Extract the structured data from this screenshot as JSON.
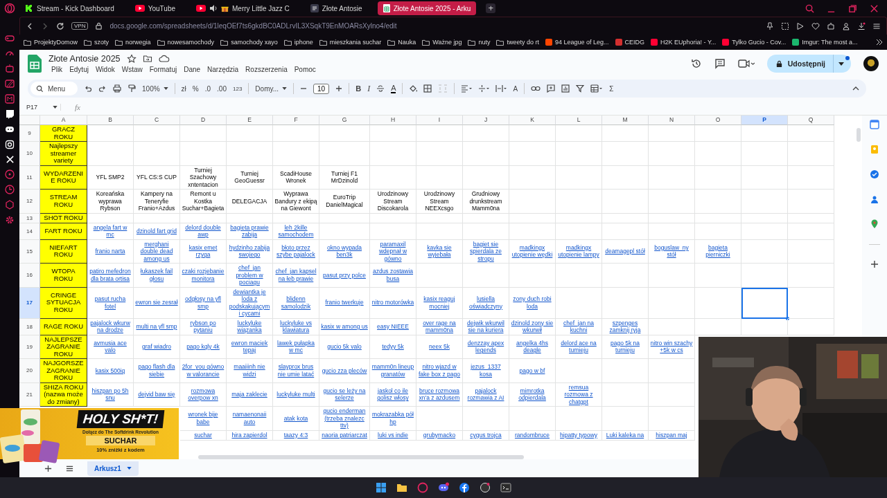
{
  "browser": {
    "tabs": [
      {
        "kind": "kick",
        "title": "Stream - Kick Dashboard",
        "selected": false
      },
      {
        "kind": "youtube",
        "title": "YouTube",
        "selected": false
      },
      {
        "kind": "media",
        "title": "Merry Little Jazz C",
        "selected": false
      },
      {
        "kind": "page",
        "title": "Złote Antosie",
        "selected": false
      },
      {
        "kind": "sheets",
        "title": "Złote Antosie 2025 - Arku",
        "selected": true
      }
    ],
    "new_tab": "+",
    "vpn": "VPN",
    "address": "docs.google.com/spreadsheets/d/1leqOEf7ts6gkdBC0ADLrvIL3XSqkT9EnMOARsXylno4/edit",
    "bookmarks": [
      {
        "kind": "folder",
        "label": "ProjektyDomow"
      },
      {
        "kind": "folder",
        "label": "szoty"
      },
      {
        "kind": "folder",
        "label": "norwegia"
      },
      {
        "kind": "folder",
        "label": "nowesamochody"
      },
      {
        "kind": "folder",
        "label": "samochody xayo"
      },
      {
        "kind": "folder",
        "label": "iphone"
      },
      {
        "kind": "folder",
        "label": "mieszkania suchar"
      },
      {
        "kind": "folder",
        "label": "Nauka"
      },
      {
        "kind": "folder",
        "label": "Ważne jpg"
      },
      {
        "kind": "folder",
        "label": "nuty"
      },
      {
        "kind": "folder",
        "label": "tweety do rt"
      },
      {
        "kind": "site",
        "label": "94 League of Leg...",
        "color": "#ff4500"
      },
      {
        "kind": "site",
        "label": "CEIDG",
        "color": "#d32f2f"
      },
      {
        "kind": "site",
        "label": "H2K EUphoria! - Y...",
        "color": "#ff0033"
      },
      {
        "kind": "site",
        "label": "Tylko Gucio - Cov...",
        "color": "#ff0033"
      },
      {
        "kind": "site",
        "label": "Imgur: The most a...",
        "color": "#1bb76e"
      }
    ]
  },
  "sheet": {
    "title": "Złote Antosie 2025",
    "menu": [
      "Plik",
      "Edytuj",
      "Widok",
      "Wstaw",
      "Formatuj",
      "Dane",
      "Narzędzia",
      "Rozszerzenia",
      "Pomoc"
    ],
    "share": "Udostępnij",
    "toolbar": {
      "search": "Menu",
      "zoom": "100%",
      "currency": "zł",
      "percent": "%",
      "decrease_decimals": ".0",
      "increase_decimals": ".00",
      "number_format": "123",
      "font": "Domy...",
      "font_size": "10",
      "bold": "B",
      "italic": "I",
      "text_color": "A",
      "text_rotation": "A",
      "functions": "Σ"
    },
    "name_box": "P17",
    "formula_label": "fx",
    "columns": [
      {
        "label": "A",
        "selected": false
      },
      {
        "label": "B",
        "selected": false
      },
      {
        "label": "C",
        "selected": false
      },
      {
        "label": "D",
        "selected": false
      },
      {
        "label": "E",
        "selected": false
      },
      {
        "label": "F",
        "selected": false
      },
      {
        "label": "G",
        "selected": false
      },
      {
        "label": "H",
        "selected": false
      },
      {
        "label": "I",
        "selected": false
      },
      {
        "label": "J",
        "selected": false
      },
      {
        "label": "K",
        "selected": false
      },
      {
        "label": "L",
        "selected": false
      },
      {
        "label": "M",
        "selected": false
      },
      {
        "label": "N",
        "selected": false
      },
      {
        "label": "O",
        "selected": false
      },
      {
        "label": "P",
        "selected": true
      },
      {
        "label": "Q",
        "selected": false
      }
    ],
    "rows": [
      {
        "number": "9",
        "selected": false,
        "category": "GRACZ ROKU"
      },
      {
        "number": "10",
        "selected": false,
        "category": "Najlepszy streamer variety"
      },
      {
        "number": "11",
        "selected": false,
        "kind": "text",
        "category": "WYDARZENIE ROKU",
        "cells": [
          "YFL SMP2",
          "YFL CS:S CUP",
          "Turniej Szachowy xntentacion",
          "Turniej GeoGuessr",
          "ScadiHouse Wronek",
          "Turniej F1 MrDzinold"
        ]
      },
      {
        "number": "12",
        "selected": false,
        "kind": "text",
        "category": "STREAM ROKU",
        "cells": [
          "Koreańska wyprawa Rybson",
          "Kampery na Teneryfie Franio+Azdus",
          "Remont u Kostka Suchar+Bagieta",
          "DELEGACJA",
          "Wyprawa Bandury z ekipą na Giewont",
          "EuroTrip DanielMagical",
          "Urodzinowy Stream Discokarola",
          "Urodzinowy Stream NEEXcsgo",
          "Grudniowy drunkstream Mamm0na"
        ]
      },
      {
        "number": "13",
        "selected": false,
        "category": "SHOT ROKU"
      },
      {
        "number": "14",
        "selected": false,
        "kind": "link",
        "category": "FART ROKU",
        "cells": [
          "angela fart w mc",
          "dzinold fart grid",
          "delord double awp",
          "bagieta prawie zabija",
          "leh 2kille samochodem"
        ]
      },
      {
        "number": "15",
        "selected": false,
        "kind": "link",
        "category": "NIEFART ROKU",
        "cells": [
          "franio narta",
          "merghani double dead among us",
          "kasix emet rzyga",
          "hydzinho zabija swojego",
          "błoto przez szybe pajalock",
          "okno wypada ben3k",
          "paramaxil wdepnał w gówno",
          "kavka sie wyjebała",
          "bagiet sie spierdala ze stropu",
          "madkingx utopienie wędki",
          "madkingx utopienie lampy",
          "deamagepl stół",
          "boguslaw_ny stół",
          "bagieta pierniczki"
        ]
      },
      {
        "number": "16",
        "selected": false,
        "kind": "link",
        "category": "WTOPA ROKU",
        "cells": [
          "patiro mefedron dla brata ortisa",
          "łukaszek fail głosu",
          "czaki rozjebanie monitora",
          "chef_jan problem w pociagu",
          "chef_jan kapsel na łeb prawie",
          "pasut przy polce",
          "azdus zostawia busa"
        ]
      },
      {
        "number": "17",
        "selected": true,
        "kind": "link",
        "category": "CRINGE SYTUACJA ROKU",
        "cells": [
          "pasut rucha fotel",
          "ewron sie zesrał",
          "odgłosy na yfl smp",
          "dewiantka je loda z podskakującym i cycami",
          "blidenn samolodzik",
          "franio twerkuje",
          "nitro motorówka",
          "kasix reaguj mocniej",
          "lusiella oświadczyny",
          "zony duch robi loda"
        ]
      },
      {
        "number": "18",
        "selected": false,
        "kind": "link",
        "category": "RAGE ROKU",
        "cells": [
          "pajalock wkurw na drodze",
          "multi na yfl smp",
          "rybson po pytaniu",
          "luckyluke wiązanka",
          "luckyluke vs klawiatura",
          "kasix w among us",
          "easy NIEEE",
          "over rage na mamm0na",
          "dejwik wkurwil sie na kuriera",
          "dzinold zony sie wkurwił",
          "chef_jan na kuchni",
          "szpenges zamknij ryja"
        ]
      },
      {
        "number": "19",
        "selected": false,
        "kind": "link",
        "category": "NAJLEPSZE ZAGRANIE ROKU",
        "cells": [
          "avmusia ace valo",
          "graf wiadro",
          "pago kqly 4k",
          "ewron maciek tepaj",
          "lawek pułapka w mc",
          "gucio 5k valo",
          "tedyy 5k",
          "neex 5k",
          "denzzay apex legends",
          "angelka 4hs deagle",
          "delord ace na turnieju",
          "pago 5k na turnieju",
          "nitro win szachy +5k w cs"
        ]
      },
      {
        "number": "20",
        "selected": false,
        "kind": "link",
        "category": "NAJGORSZE ZAGRANIE ROKU",
        "cells": [
          "kasix 500iq",
          "pago flash dla siebie",
          "2for_you gówno w valorancie",
          "maaiiinh nie widzi",
          "slayprox brus nie umie latać",
          "gucio zza pleców",
          "mamm0n lineup granatów",
          "nitro wjazd w fake box z pago",
          "jezus_1337 kosa",
          "pago w bf"
        ]
      },
      {
        "number": "21",
        "selected": false,
        "kind": "link",
        "category": "SHIZA ROKU (nazwa może do zmiany)",
        "cells": [
          "hiszpan po 5h snu",
          "dejvid baw się",
          "rozmowa overpow xn",
          "maja zaklecie",
          "luckyluke multi",
          "gucio se leży na selerze",
          "jaskol co ile golisz włosy",
          "bruce rozmowa xn'a z azdusem",
          "pajalock rozmawia z AI",
          "mimrotka odpierdala",
          "remsua rozmowa z chatgpt"
        ]
      },
      {
        "kind": "link",
        "cells": [
          null,
          null,
          "wronek bije babe",
          "namaenonaii auto",
          "atak kota",
          "gucio enderman (trzeba znalezc ttv)",
          "mokrazabka pół hp"
        ]
      },
      {
        "kind": "link",
        "cells": [
          null,
          null,
          "suchar",
          "hira zapierdol",
          "taazy 4:3",
          "naoria patriarczat",
          "luki vs indie",
          "grubymacko",
          "cygus trojca",
          "randombruce",
          "hipatty typowy",
          "Luki kaleka na",
          "hiszpan maj"
        ]
      }
    ],
    "sheet_tabs": [
      {
        "label": "Arkusz1",
        "selected": true
      }
    ]
  },
  "ad": {
    "headline": "HOLY SH*T!",
    "tagline": "Dołącz do The Softdrink Revolution",
    "code": "SUCHAR",
    "note": "10% zniżki z kodem"
  }
}
